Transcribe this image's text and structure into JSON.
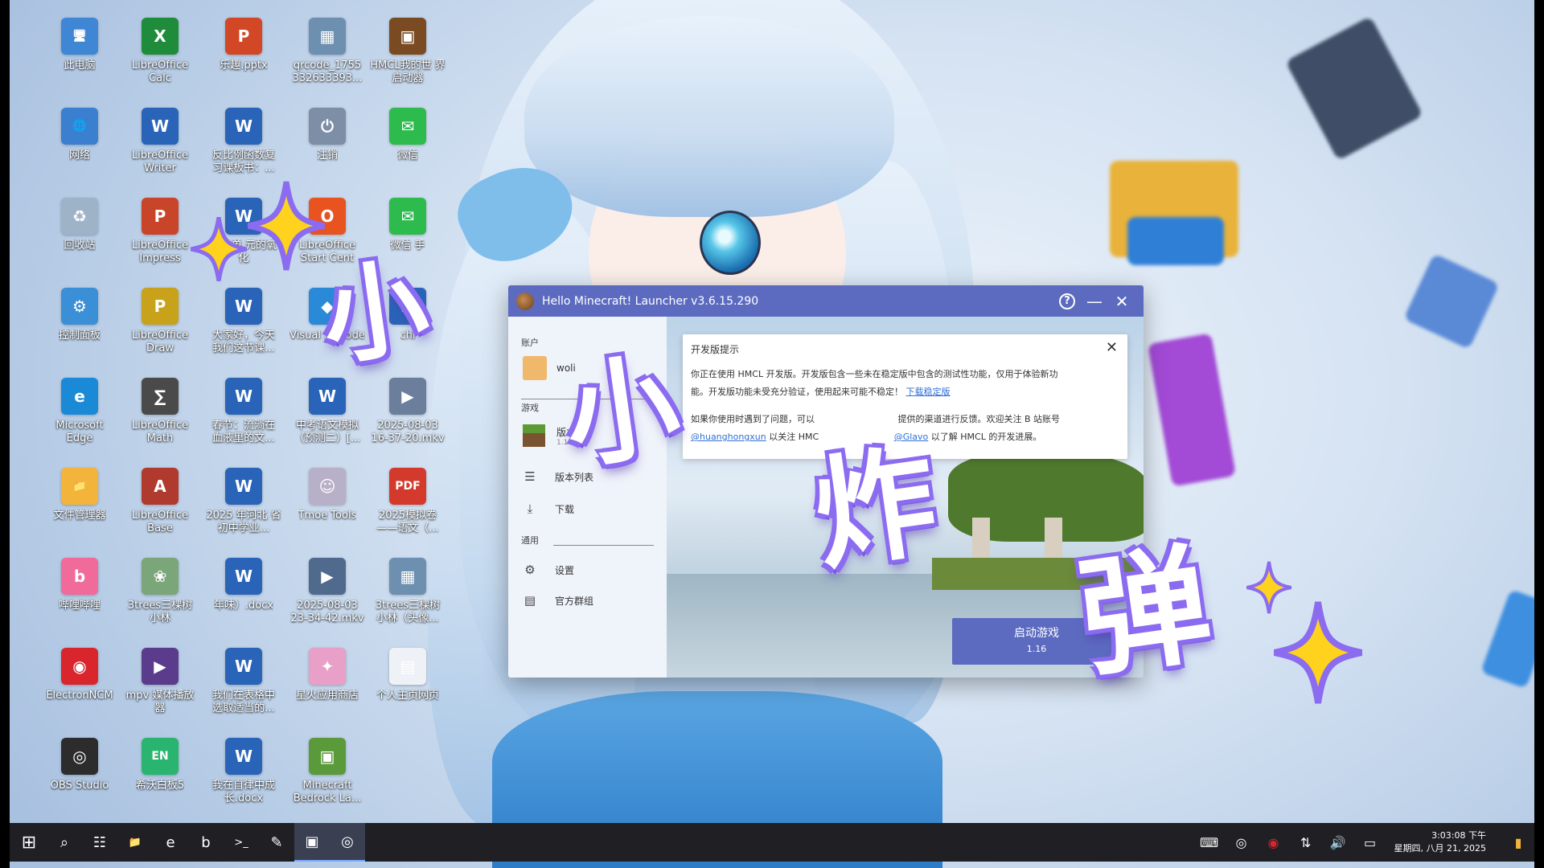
{
  "window": {
    "title": "Hello Minecraft! Launcher v3.6.15.290",
    "help_glyph": "?",
    "minimize_glyph": "—",
    "close_glyph": "✕"
  },
  "sidebar": {
    "account_section": "账户",
    "account_name": "woli",
    "game_section": "游戏",
    "version_manage": "版本管",
    "version_manage_sub": "1.16",
    "version_list": "版本列表",
    "download": "下载",
    "general_section": "通用",
    "settings": "设置",
    "official_group": "官方群组"
  },
  "notice": {
    "title": "开发版提示",
    "close_glyph": "✕",
    "line1": "你正在使用 HMCL 开发版。开发版包含一些未在稳定版中包含的测试性功能，仅用于体验新功",
    "line2_text": "能。开发版功能未受充分验证，使用起来可能不稳定！",
    "line2_link": "下载稳定版",
    "line3": "如果你使用时遇到了问题，可以",
    "line3_tail": "提供的渠道进行反馈。欢迎关注 B 站账号",
    "line4_link1": "@huanghongxun",
    "line4_mid": "以关注 HMC",
    "line4_link2": "@Glavo",
    "line4_tail": "以了解 HMCL 的开发进展。"
  },
  "launch": {
    "label": "启动游戏",
    "version": "1.16"
  },
  "overlay": {
    "c1": "小",
    "c2": "小",
    "c3": "炸",
    "c4": "弹"
  },
  "desktop_icons": [
    {
      "label": "此电脑",
      "glyph": "🖥",
      "color": "#3f86d4"
    },
    {
      "label": "LibreOffice Calc",
      "glyph": "X",
      "color": "#1e8c3a"
    },
    {
      "label": "乐趣.pptx",
      "glyph": "P",
      "color": "#d24726"
    },
    {
      "label": "qrcode_1755 332633393...",
      "glyph": "▦",
      "color": "#6d8fb0"
    },
    {
      "label": "HMCL我的世 界启动器",
      "glyph": "▣",
      "color": "#7a4a22"
    },
    {
      "label": "网络",
      "glyph": "🌐",
      "color": "#3b7fd0"
    },
    {
      "label": "LibreOffice Writer",
      "glyph": "W",
      "color": "#2a64b8"
    },
    {
      "label": "反比例函数复 习课板书：...",
      "glyph": "W",
      "color": "#2a64b8"
    },
    {
      "label": "注销",
      "glyph": "⏻",
      "color": "#7d8fa6"
    },
    {
      "label": "微信",
      "glyph": "✉",
      "color": "#2dbb4e"
    },
    {
      "label": "回收站",
      "glyph": "♻",
      "color": "#9fb3c8"
    },
    {
      "label": "LibreOffice Impress",
      "glyph": "P",
      "color": "#c8452a"
    },
    {
      "label": "第元单 元的氧化",
      "glyph": "W",
      "color": "#2a64b8"
    },
    {
      "label": "LibreOffice Start Cent",
      "glyph": "O",
      "color": "#e8531f"
    },
    {
      "label": "微信 手",
      "glyph": "✉",
      "color": "#2dbb4e"
    },
    {
      "label": "控制面板",
      "glyph": "⚙",
      "color": "#3a8fd6"
    },
    {
      "label": "LibreOffice Draw",
      "glyph": "P",
      "color": "#c8a21a"
    },
    {
      "label": "大家好，今天 我们这节课...",
      "glyph": "W",
      "color": "#2a64b8"
    },
    {
      "label": "Visual St Code",
      "glyph": "◆",
      "color": "#2b8ad8"
    },
    {
      "label": "chi",
      "glyph": "W",
      "color": "#2a64b8"
    },
    {
      "label": "Microsoft Edge",
      "glyph": "e",
      "color": "#1b8ad6"
    },
    {
      "label": "LibreOffice Math",
      "glyph": "∑",
      "color": "#4a4a4a"
    },
    {
      "label": "春节：流淌在 血液里的文...",
      "glyph": "W",
      "color": "#2a64b8"
    },
    {
      "label": "中考语文模拟 （预测二）[...",
      "glyph": "W",
      "color": "#2a64b8"
    },
    {
      "label": "2025-08-03 16-37-20.mkv",
      "glyph": "▶",
      "color": "#6b7f9c"
    },
    {
      "label": "文件管理器",
      "glyph": "📁",
      "color": "#f2b43a"
    },
    {
      "label": "LibreOffice Base",
      "glyph": "A",
      "color": "#b03a2e"
    },
    {
      "label": "2025 年河北 省初中学业...",
      "glyph": "W",
      "color": "#2a64b8"
    },
    {
      "label": "Tmoe Tools",
      "glyph": "☺",
      "color": "#b7b0c8"
    },
    {
      "label": "2025模拟卷 ——语文（...",
      "glyph": "PDF",
      "color": "#d33a2c"
    },
    {
      "label": "哔哩哔哩",
      "glyph": "b",
      "color": "#f06a9a"
    },
    {
      "label": "3trees三棵树 小林",
      "glyph": "❀",
      "color": "#7aa67a"
    },
    {
      "label": "年味）.docx",
      "glyph": "W",
      "color": "#2a64b8"
    },
    {
      "label": "2025-08-03 23-34-42.mkv",
      "glyph": "▶",
      "color": "#4f6a8c"
    },
    {
      "label": "3trees三棵树 小林（头像...",
      "glyph": "▦",
      "color": "#6d8fb0"
    },
    {
      "label": "ElectronNCM",
      "glyph": "◉",
      "color": "#d8262c"
    },
    {
      "label": "mpv 媒体播放 器",
      "glyph": "▶",
      "color": "#5b3b8c"
    },
    {
      "label": "我们在表格中 选取适当的...",
      "glyph": "W",
      "color": "#2a64b8"
    },
    {
      "label": "星火应用商店",
      "glyph": "✦",
      "color": "#e8a0c8"
    },
    {
      "label": "个人主页网页",
      "glyph": "▤",
      "color": "#eef2f6"
    },
    {
      "label": "OBS Studio",
      "glyph": "◎",
      "color": "#2c2c2c"
    },
    {
      "label": "希沃白板5",
      "glyph": "EN",
      "color": "#29b56f"
    },
    {
      "label": "我在自律中成 长.docx",
      "glyph": "W",
      "color": "#2a64b8"
    },
    {
      "label": "Minecraft Bedrock La...",
      "glyph": "▣",
      "color": "#5b9a3a"
    }
  ],
  "taskbar": {
    "items": [
      {
        "name": "start-button",
        "glyph": "⊞"
      },
      {
        "name": "search-icon",
        "glyph": "⌕"
      },
      {
        "name": "task-view-icon",
        "glyph": "☷"
      },
      {
        "name": "file-explorer-icon",
        "glyph": "📁"
      },
      {
        "name": "edge-icon",
        "glyph": "e"
      },
      {
        "name": "bilibili-icon",
        "glyph": "b"
      },
      {
        "name": "terminal-icon",
        "glyph": ">_"
      },
      {
        "name": "notes-icon",
        "glyph": "✎"
      },
      {
        "name": "hmcl-taskbar-icon",
        "glyph": "▣"
      },
      {
        "name": "obs-taskbar-icon",
        "glyph": "◎"
      }
    ],
    "clock_time": "3:03:08 下午",
    "clock_date": "星期四, 八月 21, 2025"
  }
}
